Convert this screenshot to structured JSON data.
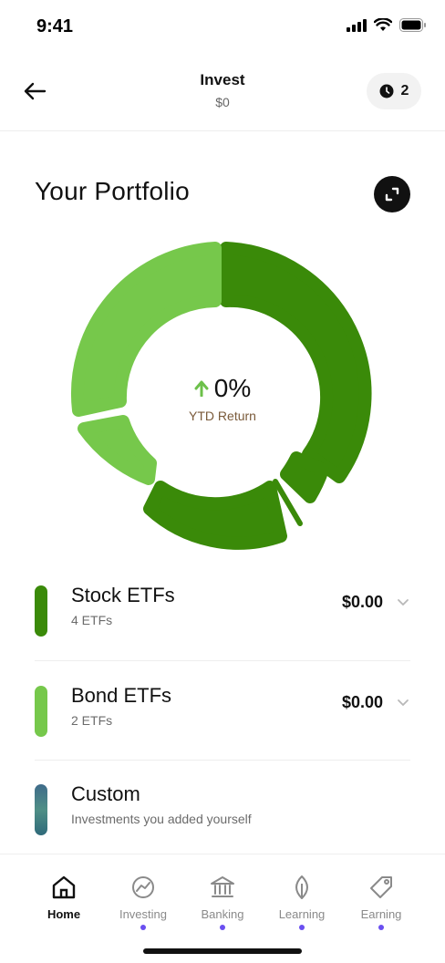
{
  "status_bar": {
    "time": "9:41"
  },
  "header": {
    "title": "Invest",
    "subtitle": "$0",
    "history_count": "2"
  },
  "portfolio": {
    "title": "Your Portfolio",
    "return_value": "0%",
    "return_label": "YTD Return",
    "colors": {
      "stock": "#3a8a09",
      "bond": "#76c84b",
      "arrow": "#6cc04a"
    }
  },
  "holdings": [
    {
      "name": "Stock ETFs",
      "sub": "4 ETFs",
      "amount": "$0.00",
      "color": "#3a8a09"
    },
    {
      "name": "Bond ETFs",
      "sub": "2 ETFs",
      "amount": "$0.00",
      "color": "#76c84b"
    },
    {
      "name": "Custom",
      "sub": "Investments you added yourself",
      "amount": "",
      "color": "gradient-teal"
    }
  ],
  "tabs": [
    {
      "label": "Home",
      "icon": "home-icon",
      "active": true
    },
    {
      "label": "Investing",
      "icon": "investing-icon",
      "active": false
    },
    {
      "label": "Banking",
      "icon": "bank-icon",
      "active": false
    },
    {
      "label": "Learning",
      "icon": "leaf-icon",
      "active": false
    },
    {
      "label": "Earning",
      "icon": "tag-icon",
      "active": false
    }
  ]
}
